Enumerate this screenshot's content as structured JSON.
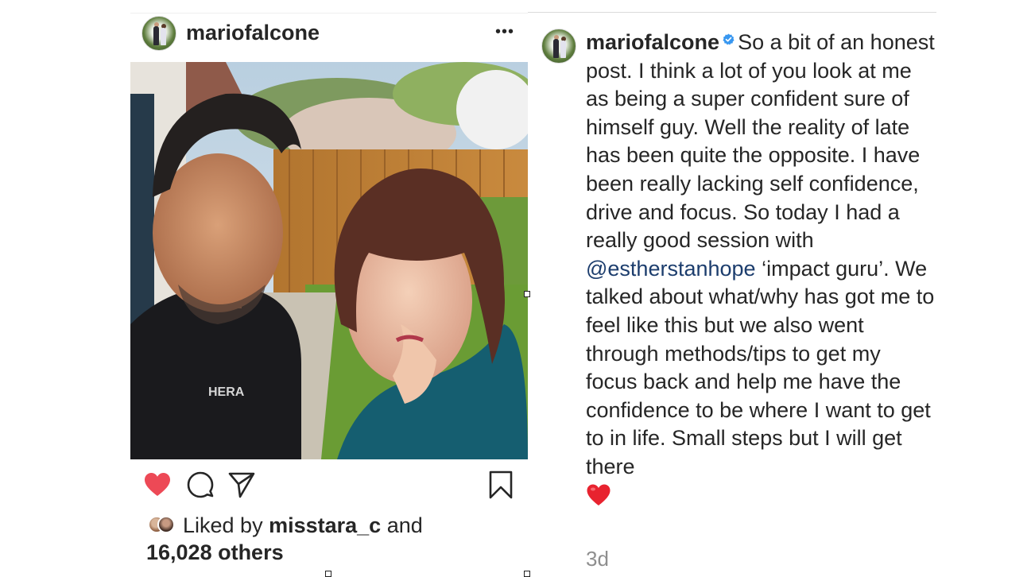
{
  "post": {
    "username": "mariofalcone",
    "more_label": "•••",
    "likes": {
      "prefix": "Liked by ",
      "liker": "misstara_c",
      "middle": " and ",
      "count": "16,028 others"
    }
  },
  "caption": {
    "username": "mariofalcone",
    "text_before_mention": "So a bit of an honest post. I think a lot of you look at me as being a super confident sure of himself guy. Well the reality of late has been quite the opposite. I have been really lacking self confidence, drive and focus. So today I had a really good session with",
    "mention": "@estherstanhope",
    "text_after_mention": "‘impact guru’. We talked about what/why has got me to feel like this but we also went through methods/tips to get my focus back and help me have the confidence to be where I want to get to in life. Small steps but I will get there",
    "emoji": "heart",
    "timestamp": "3d"
  },
  "photo": {
    "shirt_text": "HERA"
  },
  "icons": [
    "more-icon",
    "heart-icon",
    "comment-icon",
    "share-icon",
    "bookmark-icon",
    "verified-badge-icon",
    "heart-emoji-icon"
  ],
  "colors": {
    "like_red": "#ed4956",
    "mention_blue": "#1c3d6d",
    "verified_blue": "#3897f0",
    "timestamp_gray": "#8e8e8e"
  }
}
